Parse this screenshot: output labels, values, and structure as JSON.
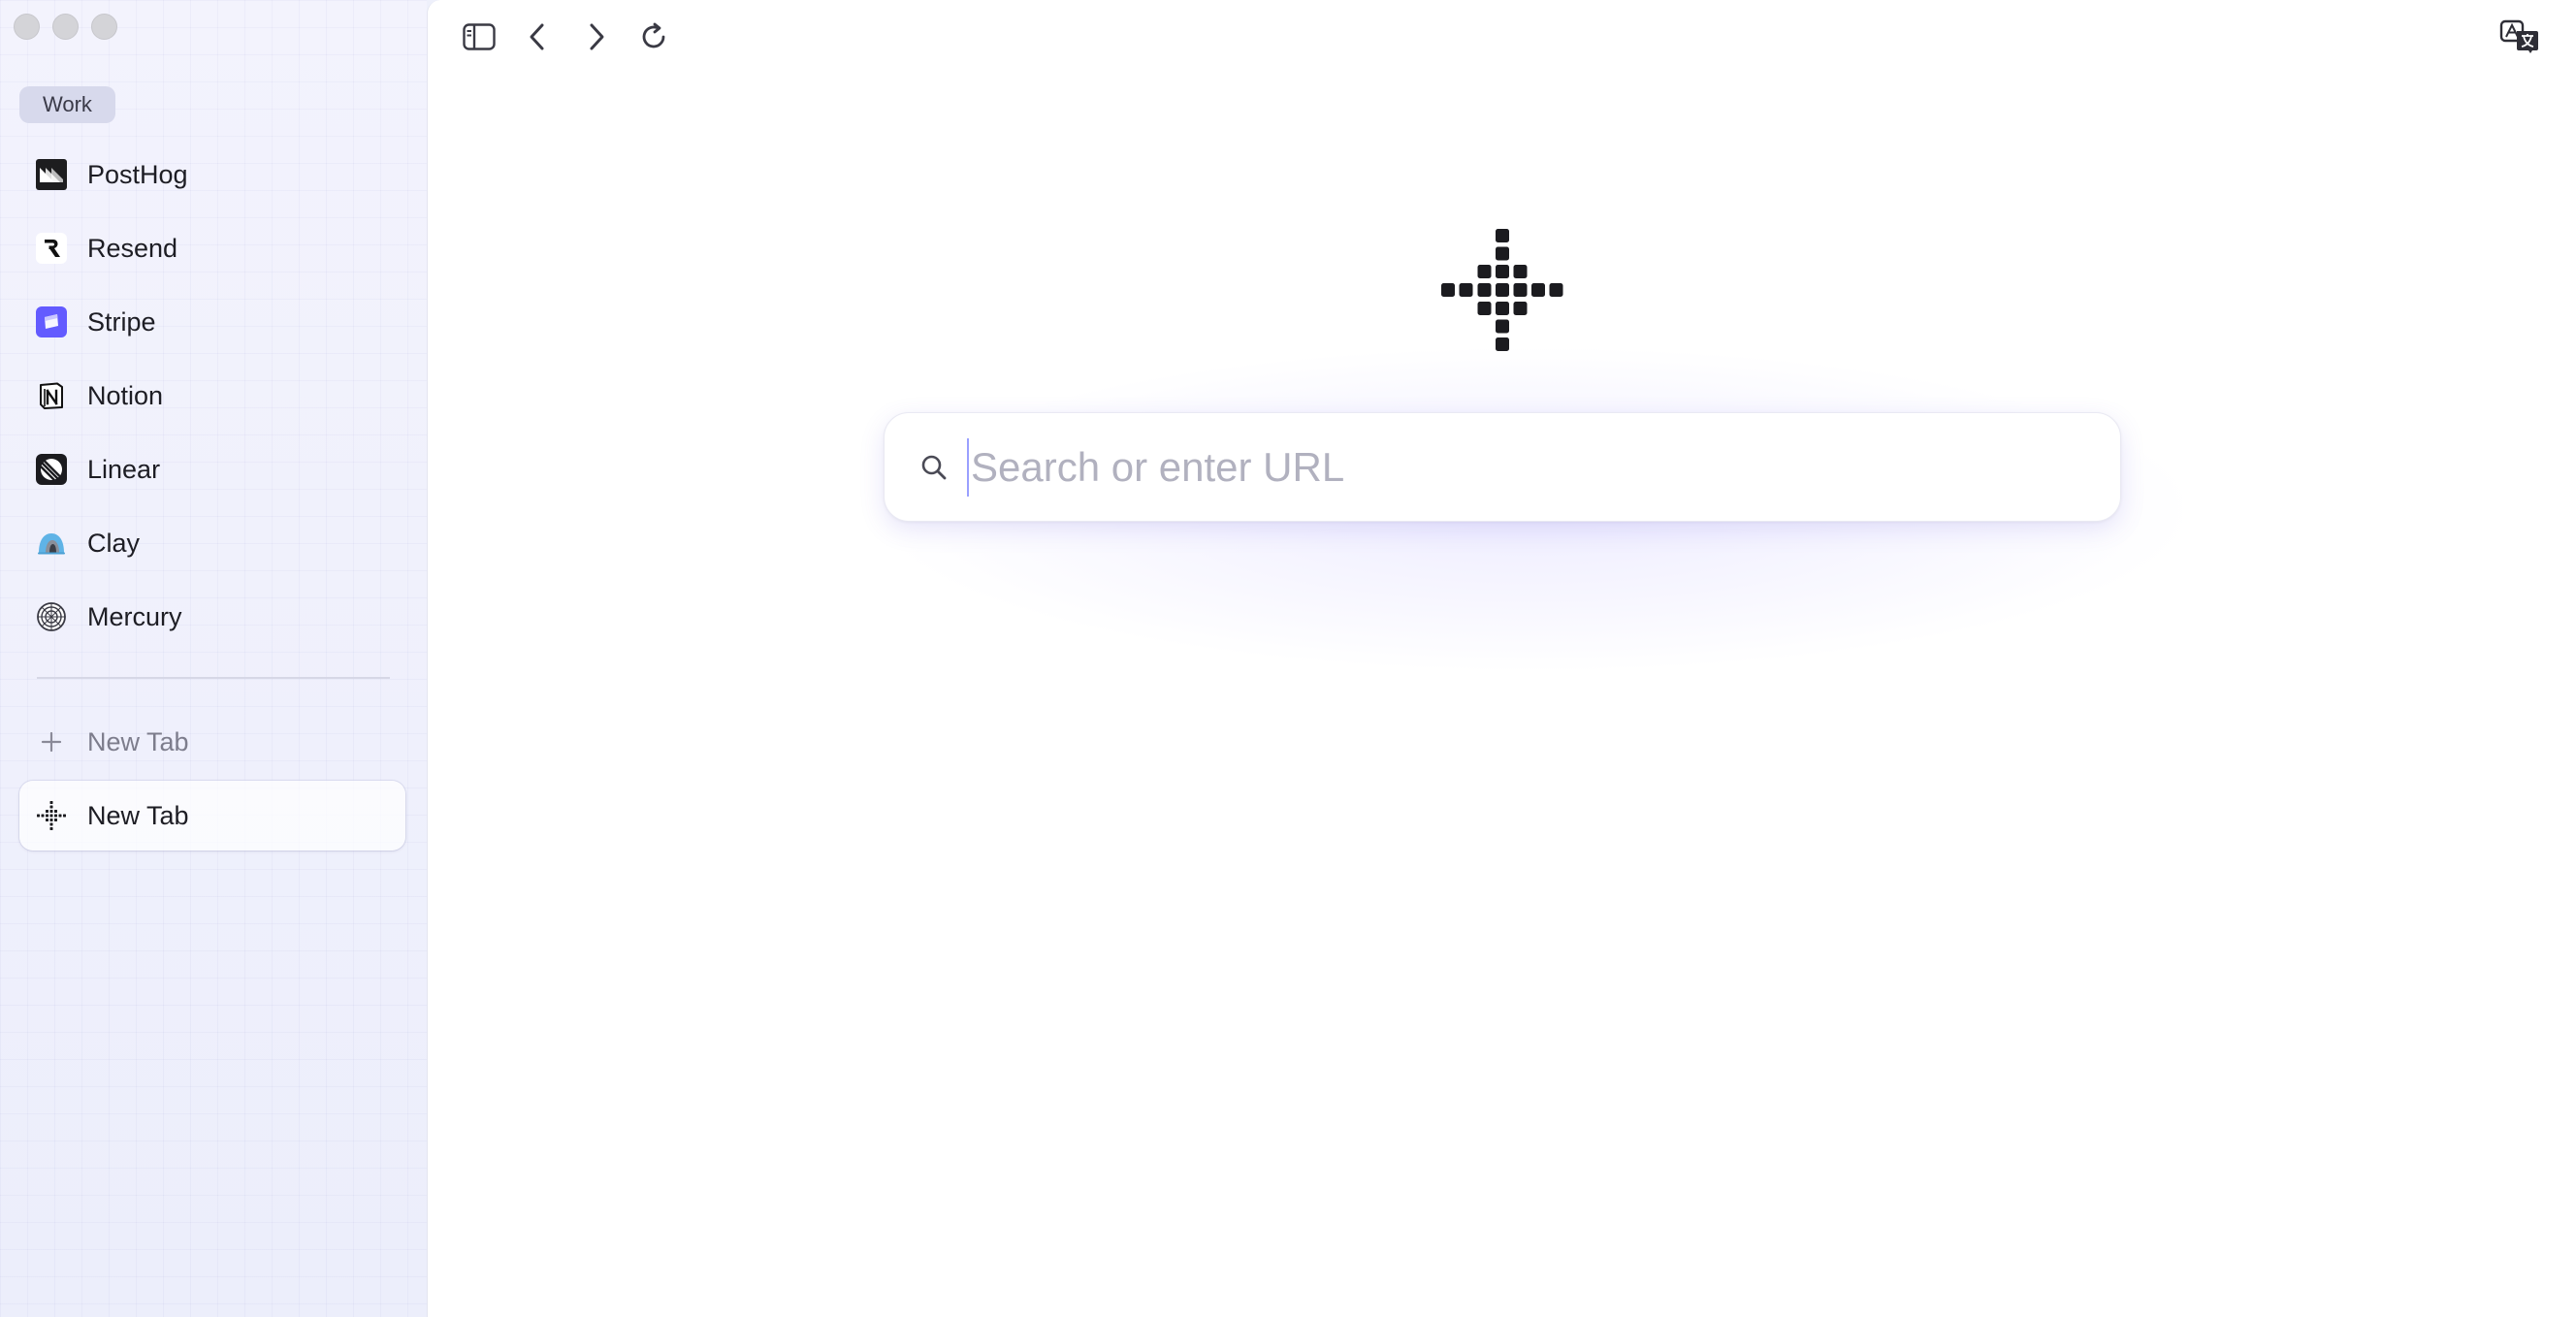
{
  "window": {
    "controls": [
      "close",
      "minimize",
      "zoom"
    ]
  },
  "sidebar": {
    "space_label": "Work",
    "pinned": [
      {
        "label": "PostHog",
        "icon": "posthog-icon"
      },
      {
        "label": "Resend",
        "icon": "resend-icon"
      },
      {
        "label": "Stripe",
        "icon": "stripe-icon"
      },
      {
        "label": "Notion",
        "icon": "notion-icon"
      },
      {
        "label": "Linear",
        "icon": "linear-icon"
      },
      {
        "label": "Clay",
        "icon": "clay-icon"
      },
      {
        "label": "Mercury",
        "icon": "mercury-icon"
      }
    ],
    "new_tab_button_label": "New Tab",
    "active_tab_label": "New Tab"
  },
  "toolbar": {
    "icons": [
      "sidebar-toggle-icon",
      "back-icon",
      "forward-icon",
      "reload-icon",
      "translate-icon"
    ]
  },
  "main": {
    "search_placeholder": "Search or enter URL",
    "search_value": ""
  },
  "colors": {
    "stripe_brand": "#635bff",
    "sidebar_bg": "#f0f1fc",
    "accent_glow": "#7a6eff"
  }
}
